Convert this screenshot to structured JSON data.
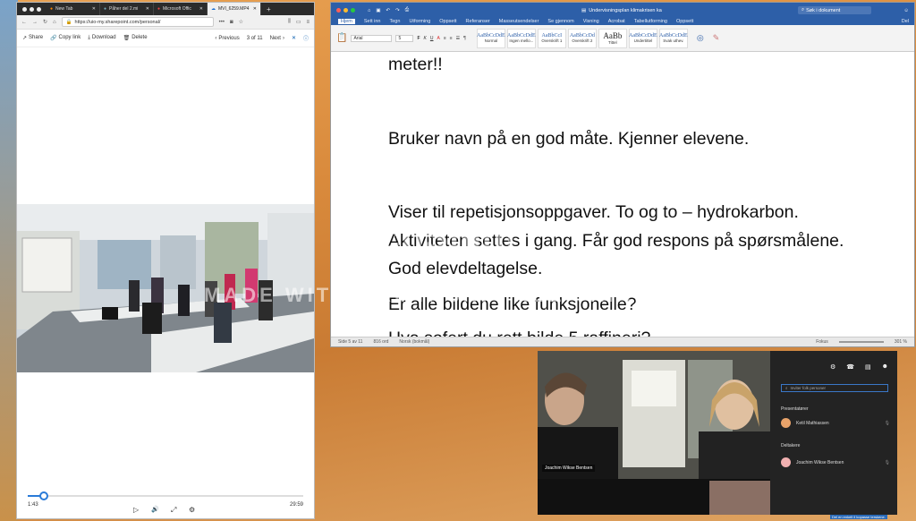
{
  "browser": {
    "tabs": [
      {
        "label": "New Tab",
        "active": false
      },
      {
        "label": "Påher del 2.mi",
        "active": false
      },
      {
        "label": "Microsoft Offic",
        "active": false
      },
      {
        "label": "MVI_6259.MP4",
        "active": true
      }
    ],
    "url": "https://uio-my.sharepoint.com/personal/",
    "toolbar": {
      "share": "Share",
      "copy_link": "Copy link",
      "download": "Download",
      "delete": "Delete",
      "previous": "Previous",
      "counter": "3 of 11",
      "next": "Next"
    },
    "player": {
      "current_time": "1:43",
      "duration": "29:59",
      "progress": 0.06
    }
  },
  "word": {
    "title": "Undervisningsplan klimakrisen ka",
    "search_placeholder": "Søk i dokument",
    "user": "Del",
    "menu": [
      "Hjem",
      "Sett inn",
      "Tegn",
      "Utforming",
      "Oppsett",
      "Referanser",
      "Masseutsendelser",
      "Se gjennom",
      "Visning",
      "Acrobat",
      "Tabellutforming",
      "Oppsett"
    ],
    "font_name": "Arial",
    "font_size": "5",
    "styles": [
      {
        "preview": "AaBbCcDdE",
        "name": "Normal"
      },
      {
        "preview": "AaBbCcDdE",
        "name": "Ingen mello..."
      },
      {
        "preview": "AaBbCcI",
        "name": "Overskrift 1"
      },
      {
        "preview": "AaBbCcDd",
        "name": "Overskrift 2"
      },
      {
        "preview": "AaBb",
        "name": "Tittel"
      },
      {
        "preview": "AaBbCcDdE",
        "name": "Undertittel"
      },
      {
        "preview": "AaBbCcDdE",
        "name": "Svak uthev."
      }
    ],
    "paragraphs": [
      "meter!!",
      "Bruker navn på en god måte. Kjenner elevene.",
      "Viser til repetisjonsoppgaver. To og to – hydrokarbon.",
      "Aktiviteten settes i gang. Får god respons på spørsmålene.",
      "God elevdeltagelse.",
      "Er alle bildene like funksjonelle?",
      "Hva sofert du rett bilde 5 raffineri?"
    ],
    "status": {
      "page": "Side 5 av 11",
      "words": "816 ord",
      "language": "Norsk (bokmål)",
      "focus": "Fokus",
      "zoom": "301 %"
    }
  },
  "teams": {
    "video_label": "Joachim Wikse Bentsen",
    "search_placeholder": "Inviter folk personer",
    "presenters_heading": "Presentatører",
    "presenters": [
      {
        "name": "Ketil Mathiassen",
        "color": "#e8a36a"
      }
    ],
    "attendees_heading": "Deltakere",
    "attendees": [
      {
        "name": "Joachim Wikse Bentsen",
        "color": "#f1b0b0"
      }
    ],
    "footer_hint": "Del en enkelt il kopasse terskene."
  },
  "watermark": {
    "line1": "TechSmith",
    "line2": "MADE WITH CAMTASIA FREE TRIAL"
  }
}
